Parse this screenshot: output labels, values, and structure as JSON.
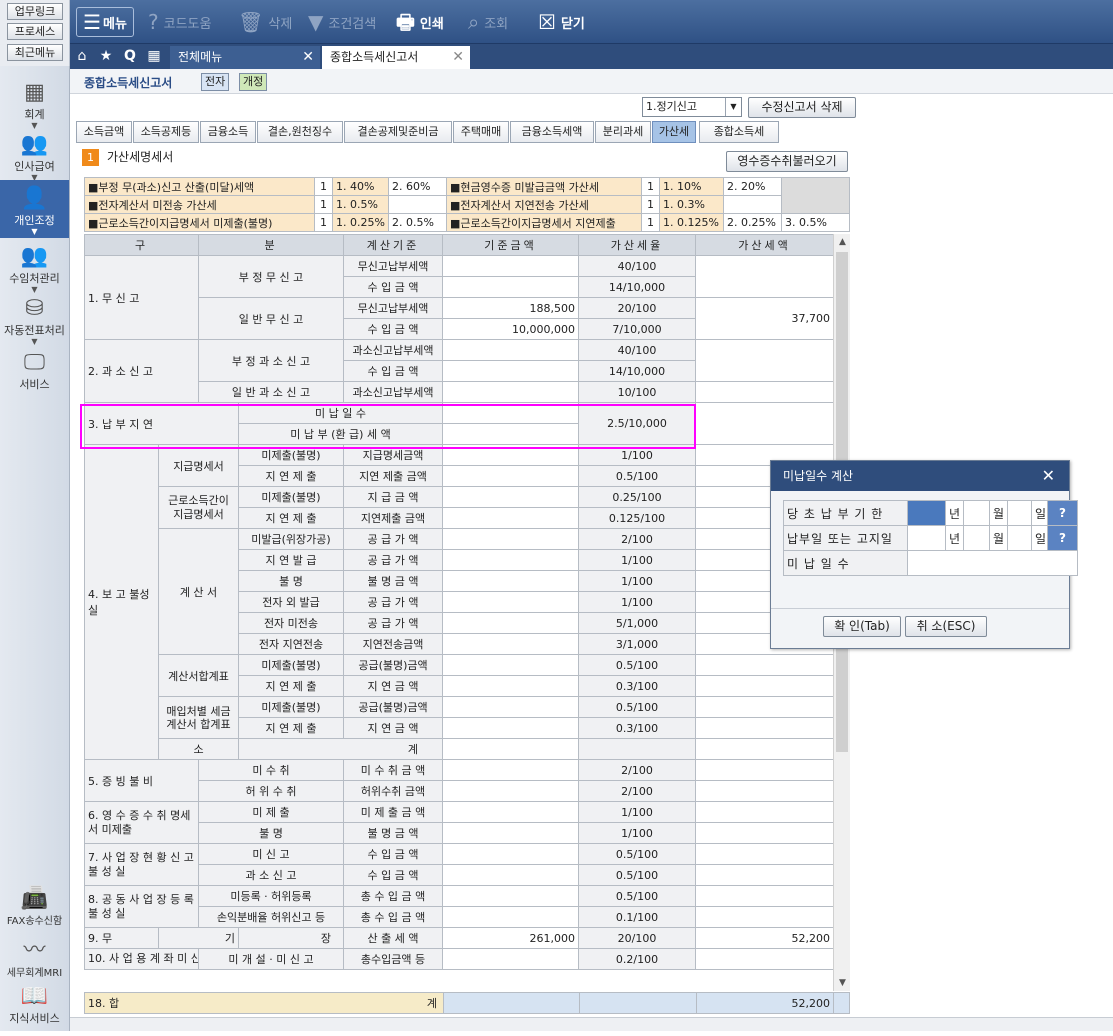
{
  "left_top_buttons": [
    "업무링크",
    "프로세스",
    "최근메뉴"
  ],
  "toolbar": {
    "menu": "메뉴",
    "code_help": "코드도움",
    "delete": "삭제",
    "search": "조건검색",
    "print": "인쇄",
    "view": "조회",
    "close": "닫기"
  },
  "sidenav": {
    "items": [
      "회계",
      "인사급여",
      "개인조정",
      "수임처관리",
      "자동전표처리",
      "서비스"
    ],
    "bottom": [
      "FAX송수신함",
      "세무회계MRI",
      "지식서비스"
    ]
  },
  "tabs": {
    "all_menu": "전체메뉴",
    "current": "종합소득세신고서"
  },
  "page": {
    "title": "종합소득세신고서",
    "badge1": "전자",
    "badge2": "개정",
    "filing_type": "1.정기신고",
    "delete_amend": "수정신고서 삭제",
    "section_no": "1",
    "section_title": "가산세명세서",
    "load_receipt": "영수증수취불러오기"
  },
  "subtabs": [
    "소득금액",
    "소득공제등",
    "금융소득",
    "결손,원천징수",
    "결손공제및준비금",
    "주택매매",
    "금융소득세액",
    "분리과세",
    "가산세",
    "종합소득세"
  ],
  "rates": [
    [
      "■부정 무(과소)신고 산출(미달)세액",
      "1",
      "1. 40%",
      "2. 60%",
      "■현금영수증 미발급금액 가산세",
      "1",
      "1. 10%",
      "2. 20%",
      ""
    ],
    [
      "■전자계산서 미전송 가산세",
      "1",
      "1. 0.5%",
      "",
      "■전자계산서 지연전송 가산세",
      "1",
      "1. 0.3%",
      "",
      ""
    ],
    [
      "■근로소득간이지급명세서 미제출(불명)",
      "1",
      "1. 0.25%",
      "2. 0.5%",
      "■근로소득간이지급명세서 지연제출",
      "1",
      "1. 0.125%",
      "2. 0.25%",
      "3. 0.5%"
    ]
  ],
  "headers": [
    "구",
    "분",
    "계산기준",
    "기준금액",
    "가산세율",
    "가산세액"
  ],
  "rows": {
    "r1": "1. 무 신 고",
    "r1a": "부 정 무 신 고",
    "r1a1b": "무신고납부세액",
    "r1a1r": "40/100",
    "r1a2b": "수 입 금 액",
    "r1a2r": "14/10,000",
    "r1b": "일 반 무 신 고",
    "r1b1b": "무신고납부세액",
    "r1b1v": "188,500",
    "r1b1r": "20/100",
    "r1b2b": "수 입 금 액",
    "r1b2v": "10,000,000",
    "r1b2r": "7/10,000",
    "r1tax": "37,700",
    "r2": "2. 과 소 신 고",
    "r2a": "부 정 과 소 신 고",
    "r2a1b": "과소신고납부세액",
    "r2a1r": "40/100",
    "r2a2b": "수 입 금 액",
    "r2a2r": "14/10,000",
    "r2b": "일 반 과 소 신 고",
    "r2b1b": "과소신고납부세액",
    "r2b1r": "10/100",
    "r3": "3. 납 부 지 연",
    "r3a": "미 납 일 수",
    "r3b": "미 납 부 (환 급) 세 액",
    "r3r": "2.5/10,000",
    "r4": "4. 보 고 불성실",
    "g1": "지급명세서",
    "g1a": "미제출(불명)",
    "g1ab": "지급명세금액",
    "g1ar": "1/100",
    "g1b": "지 연 제 출",
    "g1bb": "지연 제출 금액",
    "g1br": "0.5/100",
    "g2": "근로소득간이 지급명세서",
    "g2a": "미제출(불명)",
    "g2ab": "지 급 금 액",
    "g2ar": "0.25/100",
    "g2b": "지 연 제 출",
    "g2bb": "지연제출 금액",
    "g2br": "0.125/100",
    "g3": "계 산 서",
    "g3a": "미발급(위장가공)",
    "g3ab": "공 급 가 액",
    "g3ar": "2/100",
    "g3b": "지 연 발 급",
    "g3bb": "공 급 가 액",
    "g3br": "1/100",
    "g3c": "불 명",
    "g3cb": "불 명 금 액",
    "g3cr": "1/100",
    "g3d": "전자 외 발급",
    "g3db": "공 급 가 액",
    "g3dr": "1/100",
    "g3e": "전자 미전송",
    "g3eb": "공 급 가 액",
    "g3er": "5/1,000",
    "g3f": "전자 지연전송",
    "g3fb": "지연전송금액",
    "g3fr": "3/1,000",
    "g4": "계산서합계표",
    "g4a": "미제출(불명)",
    "g4ab": "공급(불명)금액",
    "g4ar": "0.5/100",
    "g4b": "지 연 제 출",
    "g4bb": "지 연 금 액",
    "g4br": "0.3/100",
    "g5": "매입처별 세금계산서 합계표",
    "g5a": "미제출(불명)",
    "g5ab": "공급(불명)금액",
    "g5ar": "0.5/100",
    "g5b": "지 연 제 출",
    "g5bb": "지 연 금 액",
    "g5br": "0.3/100",
    "sub1": "소",
    "sub2": "계",
    "r5": "5. 증 빙 불 비",
    "r5a": "미 수 취",
    "r5ab": "미 수 취 금 액",
    "r5ar": "2/100",
    "r5b": "허 위 수 취",
    "r5bb": "허위수취 금액",
    "r5br": "2/100",
    "r6": "6. 영 수 증 수 취 명세서 미제출",
    "r6a": "미 제 출",
    "r6ab": "미 제 출 금 액",
    "r6ar": "1/100",
    "r6b": "불 명",
    "r6bb": "불 명 금 액",
    "r6br": "1/100",
    "r7": "7. 사 업 장 현 황 신 고 불 성 실",
    "r7a": "미 신 고",
    "r7ab": "수 입 금 액",
    "r7ar": "0.5/100",
    "r7b": "과 소 신 고",
    "r7bb": "수 입 금 액",
    "r7br": "0.5/100",
    "r8": "8. 공 동 사 업 장 등 록 불 성 실",
    "r8a": "미등록 · 허위등록",
    "r8ab": "총 수 입 금 액",
    "r8ar": "0.5/100",
    "r8b": "손익분배율 허위신고 등",
    "r8bb": "총 수 입 금 액",
    "r8br": "0.1/100",
    "r9": "9. 무",
    "r9m": "기",
    "r9e": "장",
    "r9b": "산 출 세 액",
    "r9v": "261,000",
    "r9r": "20/100",
    "r9tax": "52,200",
    "r10": "10. 사 업 용 계 좌 미 신 고 등",
    "r10a": "미 개 설 · 미 신 고",
    "r10ab": "총수입금액 등",
    "r10ar": "0.2/100",
    "r18": "18. 합",
    "r18e": "계",
    "r18tax": "52,200"
  },
  "dialog": {
    "title": "미납일수 계산",
    "row1": "당 초 납 부 기 한",
    "row2": "납부일 또는 고지일",
    "row3": "미 납 일 수",
    "year": "년",
    "month": "월",
    "day": "일",
    "help": "?",
    "ok": "확 인(Tab)",
    "cancel": "취 소(ESC)"
  },
  "colors": {
    "highlight": "#ff00ff",
    "toolbar": "#3a5d92",
    "active_nav": "#3a66a8"
  }
}
